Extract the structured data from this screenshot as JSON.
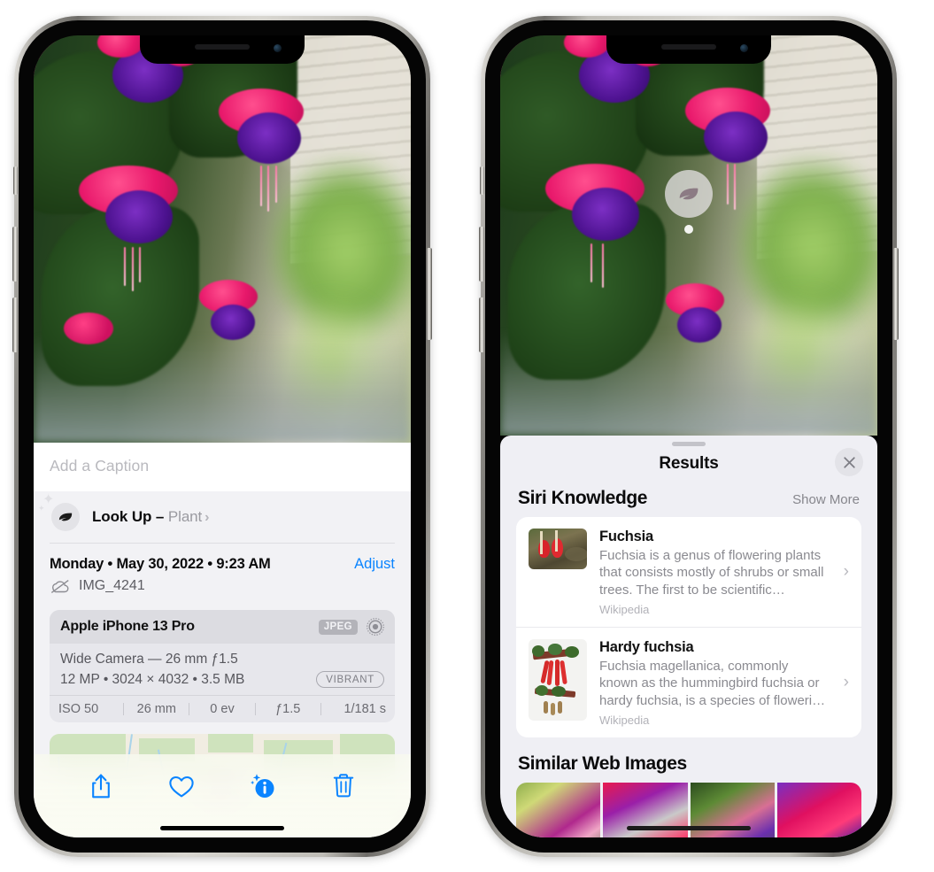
{
  "left_phone": {
    "caption_placeholder": "Add a Caption",
    "lookup": {
      "label": "Look Up –",
      "subject": "Plant",
      "chevron": "›",
      "icon": "leaf-icon"
    },
    "metadata": {
      "date_line": "Monday • May 30, 2022 • 9:23 AM",
      "adjust_label": "Adjust",
      "filename": "IMG_4241",
      "cloud_icon": "cloud-slash-icon"
    },
    "exif": {
      "device": "Apple iPhone 13 Pro",
      "format_badge": "JPEG",
      "lens_icon": "aperture-icon",
      "lens_line": "Wide Camera — 26 mm ƒ1.5",
      "size_line": "12 MP • 3024 × 4032 • 3.5 MB",
      "style_badge": "VIBRANT",
      "stats": [
        "ISO 50",
        "26 mm",
        "0 ev",
        "ƒ1.5",
        "1/181 s"
      ]
    },
    "toolbar": [
      {
        "name": "share-button",
        "icon": "share-icon"
      },
      {
        "name": "favorite-button",
        "icon": "heart-icon"
      },
      {
        "name": "info-button",
        "icon": "info-sparkle-icon"
      },
      {
        "name": "delete-button",
        "icon": "trash-icon"
      }
    ]
  },
  "right_phone": {
    "badge_icon": "leaf-icon",
    "results": {
      "title": "Results",
      "close_icon": "close-icon",
      "sections": [
        {
          "title": "Siri Knowledge",
          "action": "Show More",
          "items": [
            {
              "title": "Fuchsia",
              "description": "Fuchsia is a genus of flowering plants that consists mostly of shrubs or small trees. The first to be scientific…",
              "source": "Wikipedia"
            },
            {
              "title": "Hardy fuchsia",
              "description": "Fuchsia magellanica, commonly known as the hummingbird fuchsia or hardy fuchsia, is a species of floweri…",
              "source": "Wikipedia"
            }
          ]
        },
        {
          "title": "Similar Web Images",
          "images": [
            "fuchsia-thumb-1",
            "fuchsia-thumb-2",
            "fuchsia-thumb-3",
            "fuchsia-thumb-4"
          ]
        }
      ]
    }
  },
  "colors": {
    "accent": "#0a84ff",
    "sheet_bg": "#f2f2f5",
    "results_bg": "#efeff4",
    "card_bg": "#ffffff",
    "muted_text": "#8a8a90"
  }
}
